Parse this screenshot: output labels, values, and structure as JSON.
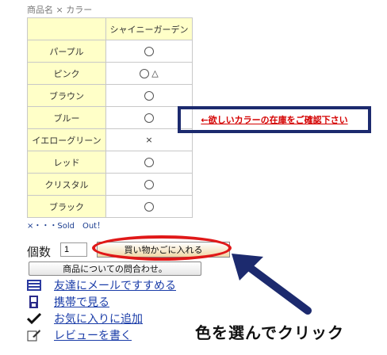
{
  "header": {
    "label": "商品名 × カラー"
  },
  "table": {
    "column_header": "シャイニーガーデン",
    "rows": [
      {
        "color": "パープル",
        "stock": "radio",
        "note": ""
      },
      {
        "color": "ピンク",
        "stock": "radio",
        "note": "△"
      },
      {
        "color": "ブラウン",
        "stock": "radio",
        "note": ""
      },
      {
        "color": "ブルー",
        "stock": "radio",
        "note": ""
      },
      {
        "color": "イエローグリーン",
        "stock": "soldout",
        "note": "×"
      },
      {
        "color": "レッド",
        "stock": "radio",
        "note": ""
      },
      {
        "color": "クリスタル",
        "stock": "radio",
        "note": ""
      },
      {
        "color": "ブラック",
        "stock": "radio",
        "note": ""
      }
    ]
  },
  "soldout_note": "×・・・Sold　Out！",
  "annotation": {
    "stock_text": "←欲しいカラーの在庫をご確認下さい"
  },
  "order": {
    "qty_label": "個数",
    "qty_value": "1",
    "cart_button": "買い物かごに入れる",
    "inquiry_button": "商品についての問合わせ。"
  },
  "links": [
    {
      "label": "友達にメールですすめる",
      "icon": "mail-list-icon"
    },
    {
      "label": "携帯で見る",
      "icon": "mobile-icon"
    },
    {
      "label": "お気に入りに追加",
      "icon": "checkmark-icon"
    },
    {
      "label": "レビューを書く",
      "icon": "pencil-note-icon"
    }
  ],
  "caption": "色を選んでクリック",
  "colors": {
    "annotation_red": "#d40000",
    "annotation_navy": "#1c2a6e",
    "highlight_ring": "#e01818",
    "link_blue": "#1a3ca8",
    "cell_yellow": "#ffffc8"
  }
}
